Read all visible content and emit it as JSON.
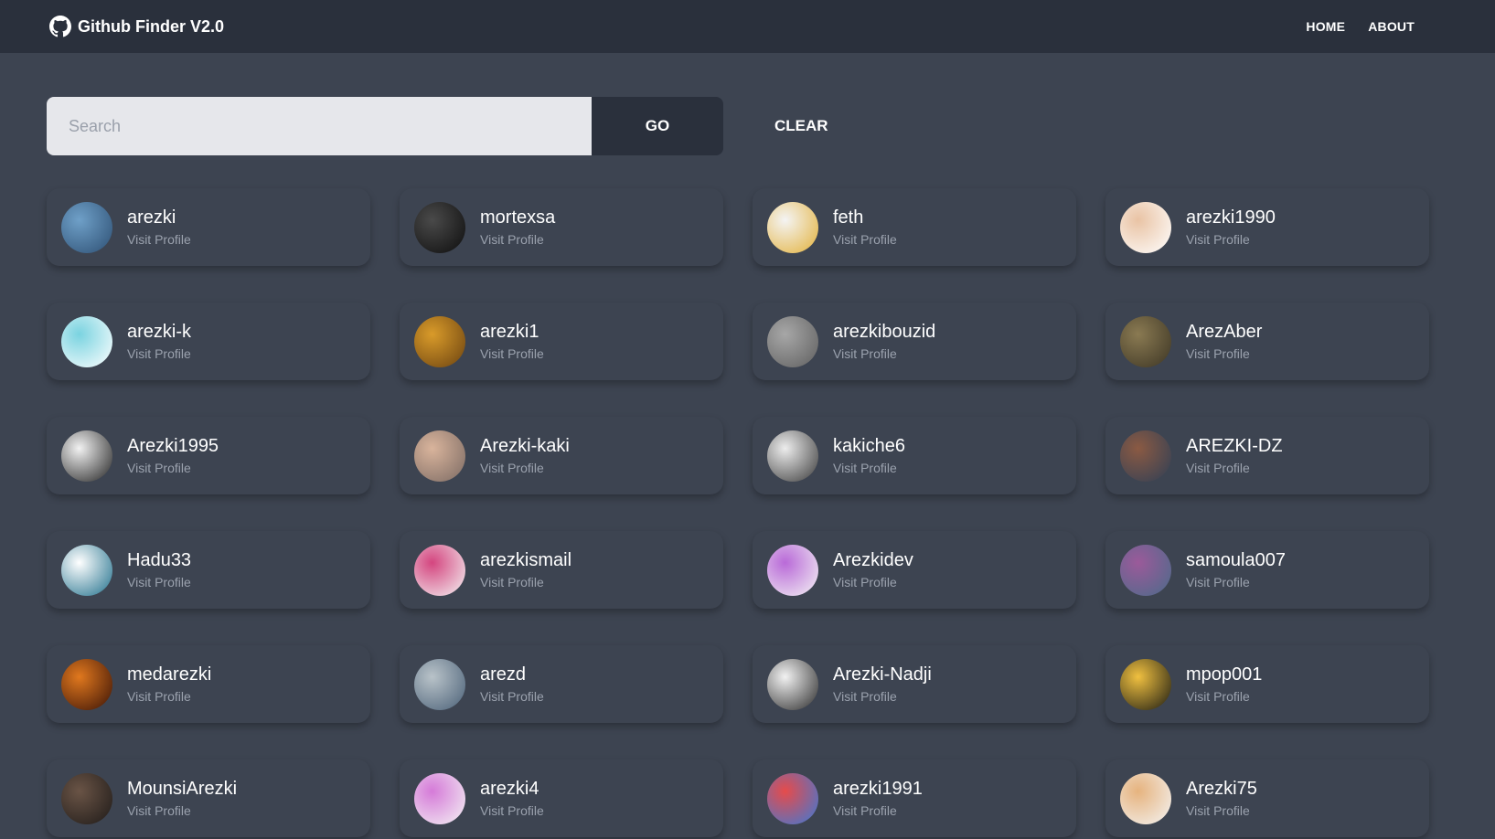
{
  "navbar": {
    "title": "Github Finder V2.0",
    "brand_icon": "github-icon",
    "links": [
      {
        "label": "HOME"
      },
      {
        "label": "ABOUT"
      }
    ]
  },
  "search": {
    "placeholder": "Search",
    "value": "",
    "go_label": "GO",
    "clear_label": "CLEAR"
  },
  "users": [
    {
      "login": "arezki",
      "link_label": "Visit Profile",
      "avatar_colors": [
        "#6fa0c8",
        "#2d4f73"
      ]
    },
    {
      "login": "mortexsa",
      "link_label": "Visit Profile",
      "avatar_colors": [
        "#4a4a4a",
        "#0d0d0d"
      ]
    },
    {
      "login": "feth",
      "link_label": "Visit Profile",
      "avatar_colors": [
        "#f4f4f4",
        "#e3b13a"
      ]
    },
    {
      "login": "arezki1990",
      "link_label": "Visit Profile",
      "avatar_colors": [
        "#e9c3a4",
        "#ffffff"
      ]
    },
    {
      "login": "arezki-k",
      "link_label": "Visit Profile",
      "avatar_colors": [
        "#7ad3e0",
        "#ffffff"
      ]
    },
    {
      "login": "arezki1",
      "link_label": "Visit Profile",
      "avatar_colors": [
        "#d99b2a",
        "#6b4210"
      ]
    },
    {
      "login": "arezkibouzid",
      "link_label": "Visit Profile",
      "avatar_colors": [
        "#a7a7a7",
        "#5f5f5f"
      ]
    },
    {
      "login": "ArezAber",
      "link_label": "Visit Profile",
      "avatar_colors": [
        "#8a7a52",
        "#3c3524"
      ]
    },
    {
      "login": "Arezki1995",
      "link_label": "Visit Profile",
      "avatar_colors": [
        "#f2f2f2",
        "#222222"
      ]
    },
    {
      "login": "Arezki-kaki",
      "link_label": "Visit Profile",
      "avatar_colors": [
        "#d9b49c",
        "#7b6a63"
      ]
    },
    {
      "login": "kakiche6",
      "link_label": "Visit Profile",
      "avatar_colors": [
        "#ededed",
        "#3a3a3a"
      ]
    },
    {
      "login": "AREZKI-DZ",
      "link_label": "Visit Profile",
      "avatar_colors": [
        "#8b5a43",
        "#2f3f55"
      ]
    },
    {
      "login": "Hadu33",
      "link_label": "Visit Profile",
      "avatar_colors": [
        "#ffffff",
        "#1f6f8b"
      ]
    },
    {
      "login": "arezkismail",
      "link_label": "Visit Profile",
      "avatar_colors": [
        "#d4457f",
        "#f4f4f4"
      ]
    },
    {
      "login": "Arezkidev",
      "link_label": "Visit Profile",
      "avatar_colors": [
        "#b96ad8",
        "#f4f4f4"
      ]
    },
    {
      "login": "samoula007",
      "link_label": "Visit Profile",
      "avatar_colors": [
        "#9b5a9a",
        "#4b6b8a"
      ]
    },
    {
      "login": "medarezki",
      "link_label": "Visit Profile",
      "avatar_colors": [
        "#e0781e",
        "#3a1206"
      ]
    },
    {
      "login": "arezd",
      "link_label": "Visit Profile",
      "avatar_colors": [
        "#b9c3c9",
        "#4a6077"
      ]
    },
    {
      "login": "Arezki-Nadji",
      "link_label": "Visit Profile",
      "avatar_colors": [
        "#f2f2f2",
        "#2a2a2a"
      ]
    },
    {
      "login": "mpop001",
      "link_label": "Visit Profile",
      "avatar_colors": [
        "#f0c040",
        "#1a1a12"
      ]
    },
    {
      "login": "MounsiArezki",
      "link_label": "Visit Profile",
      "avatar_colors": [
        "#6a5446",
        "#1e1a18"
      ]
    },
    {
      "login": "arezki4",
      "link_label": "Visit Profile",
      "avatar_colors": [
        "#d57ad8",
        "#f4f4f4"
      ]
    },
    {
      "login": "arezki1991",
      "link_label": "Visit Profile",
      "avatar_colors": [
        "#e64b4b",
        "#3a7ad8"
      ]
    },
    {
      "login": "Arezki75",
      "link_label": "Visit Profile",
      "avatar_colors": [
        "#e6b37e",
        "#f4f4f4"
      ]
    }
  ]
}
